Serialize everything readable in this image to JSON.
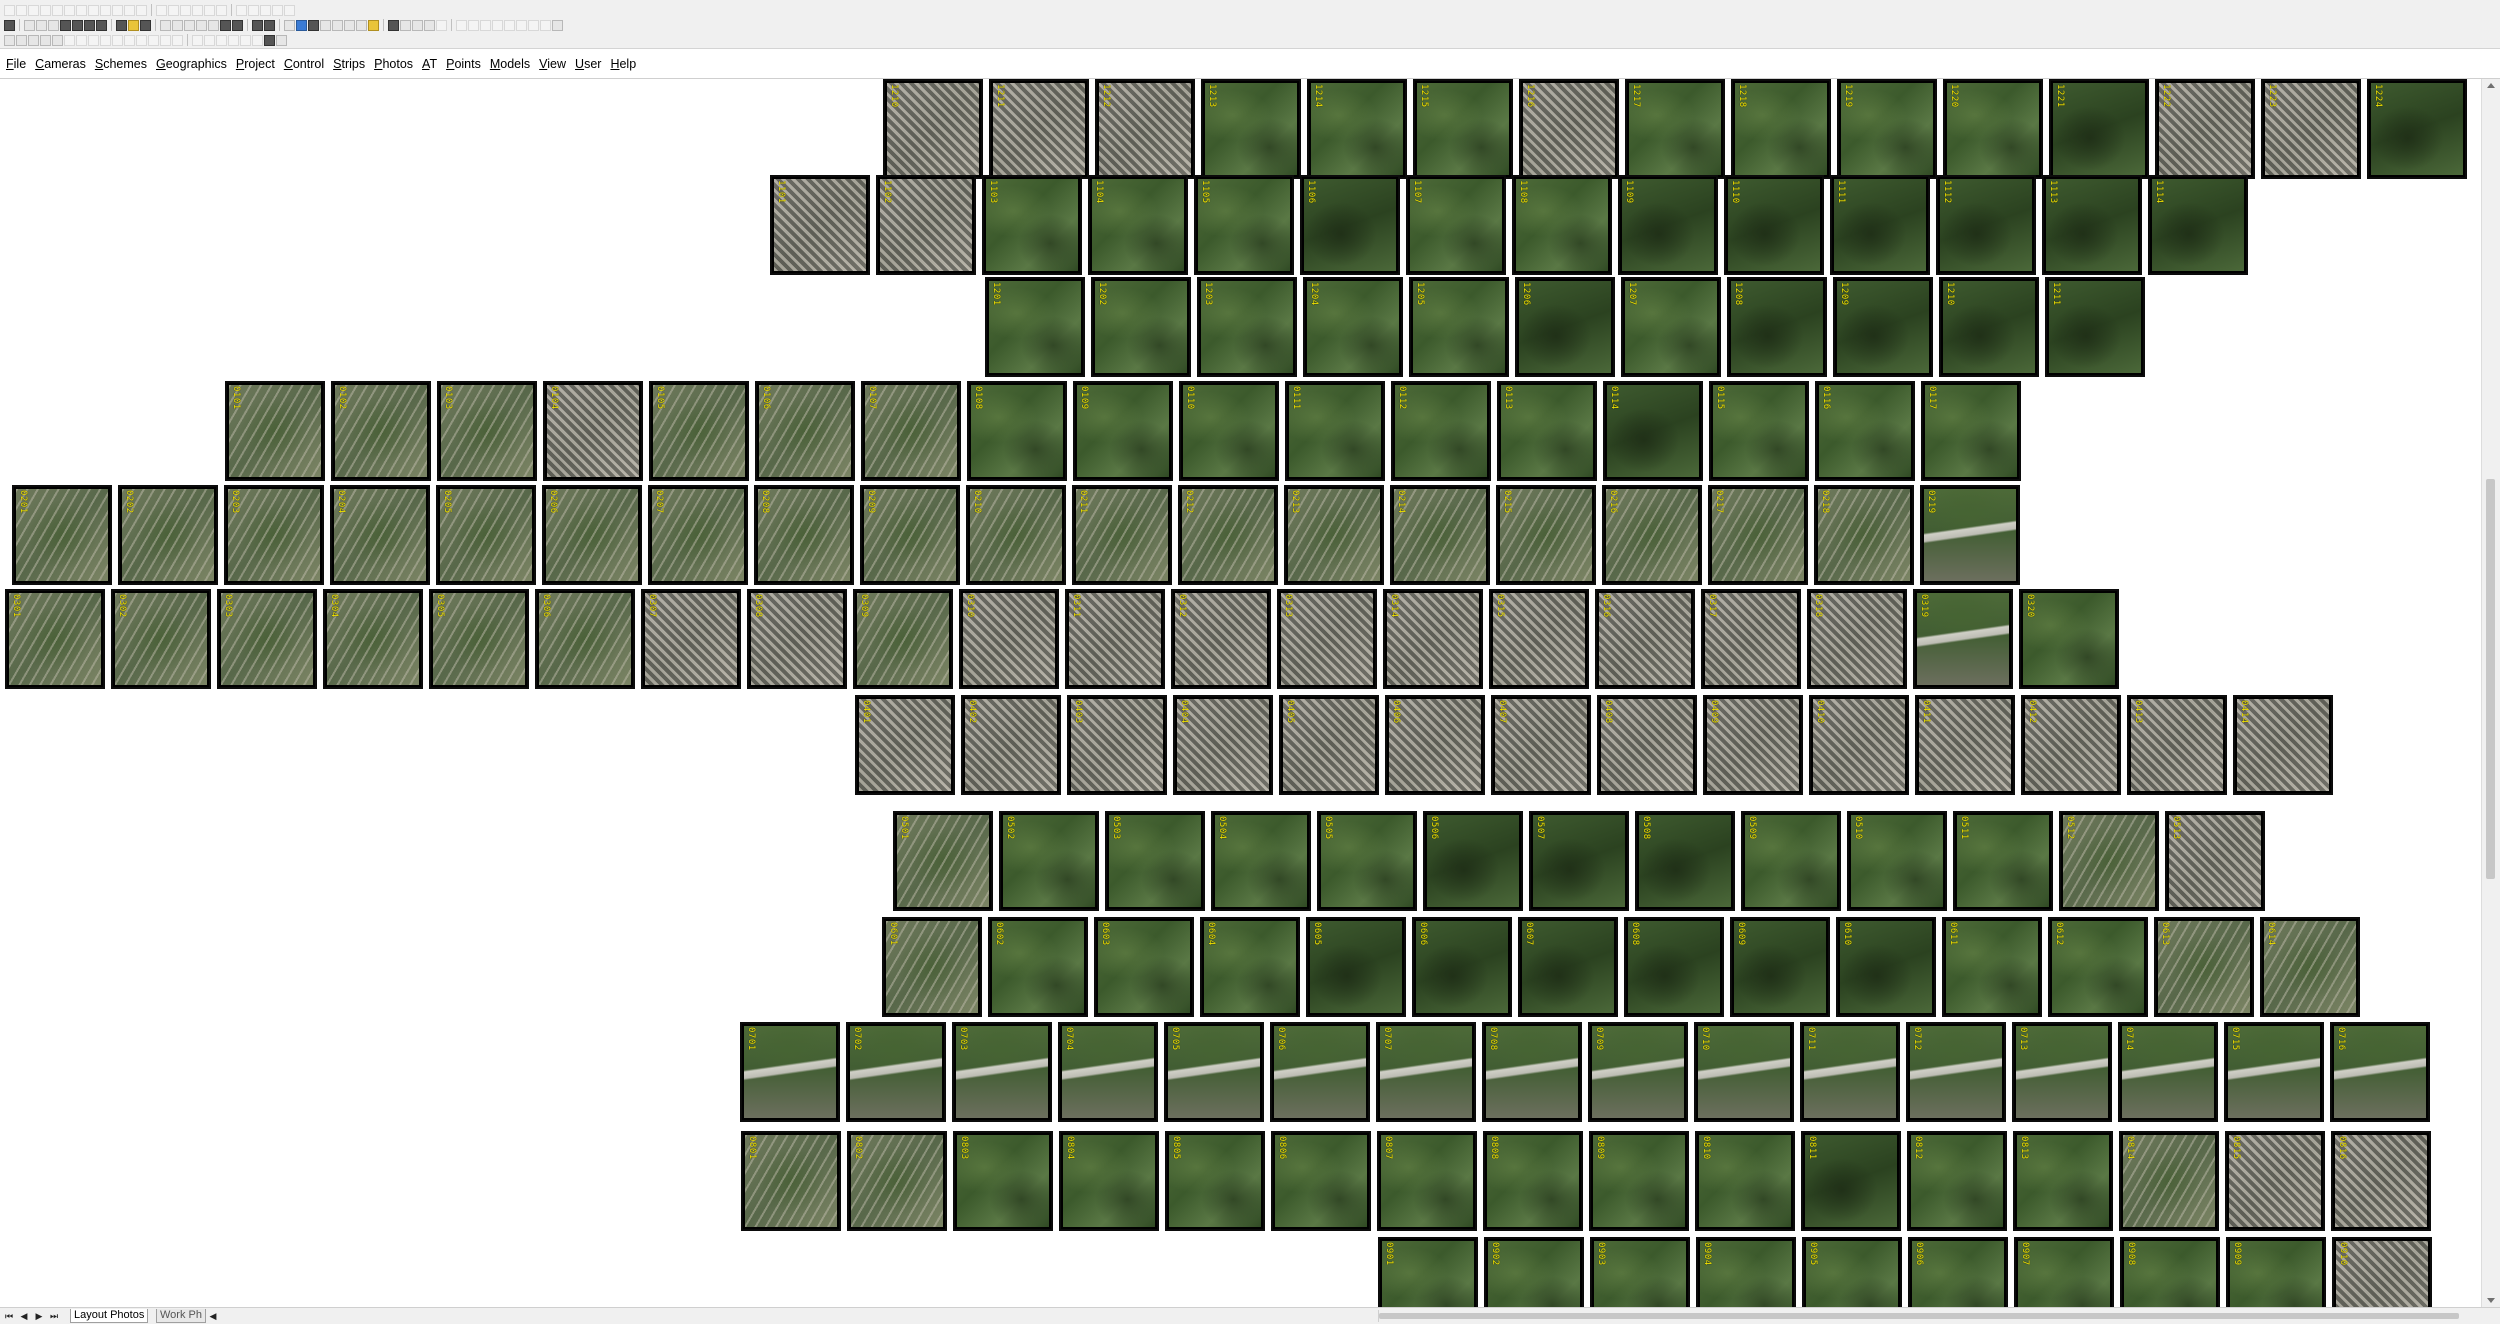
{
  "menu": [
    {
      "label": "File"
    },
    {
      "label": "Cameras"
    },
    {
      "label": "Schemes"
    },
    {
      "label": "Geographics"
    },
    {
      "label": "Project"
    },
    {
      "label": "Control"
    },
    {
      "label": "Strips"
    },
    {
      "label": "Photos"
    },
    {
      "label": "AT"
    },
    {
      "label": "Points"
    },
    {
      "label": "Models"
    },
    {
      "label": "View"
    },
    {
      "label": "User"
    },
    {
      "label": "Help"
    }
  ],
  "tabs": {
    "active": "Layout Photos",
    "inactive": "Work Ph"
  },
  "nav_icons": [
    "first-icon",
    "prev-icon",
    "next-icon",
    "last-icon"
  ],
  "colors": {
    "photo_label": "#f2e400",
    "photo_border": "#0b0b0b"
  },
  "strips": [
    {
      "start": 883,
      "count": 15,
      "offset": 0,
      "prefix": "12",
      "nums": [
        "1210",
        "1211",
        "1212",
        "1213",
        "1214",
        "1215",
        "1216",
        "1217",
        "1218",
        "1219",
        "1220",
        "1221",
        "1222",
        "1223",
        "1224"
      ]
    },
    {
      "start": 770,
      "count": 14,
      "offset": 0,
      "prefix": "11",
      "nums": [
        "1101",
        "1102",
        "1103",
        "1104",
        "1105",
        "1106",
        "1107",
        "1108",
        "1109",
        "1110",
        "1111",
        "1112",
        "1113",
        "1114"
      ]
    },
    {
      "start": 985,
      "count": 11,
      "offset": 0,
      "prefix": "12",
      "nums": [
        "1201",
        "1202",
        "1203",
        "1204",
        "1205",
        "1206",
        "1207",
        "1208",
        "1209",
        "1210",
        "1211"
      ]
    },
    {
      "start": 225,
      "count": 17,
      "offset": 0,
      "prefix": "01",
      "nums": [
        "0101",
        "0102",
        "0103",
        "0104",
        "0105",
        "0106",
        "0107",
        "0108",
        "0109",
        "0110",
        "0111",
        "0112",
        "0113",
        "0114",
        "0115",
        "0116",
        "0117"
      ]
    },
    {
      "start": 12,
      "count": 19,
      "offset": 0,
      "prefix": "02",
      "nums": [
        "0201",
        "0202",
        "0203",
        "0204",
        "0205",
        "0206",
        "0207",
        "0208",
        "0209",
        "0210",
        "0211",
        "0212",
        "0213",
        "0214",
        "0215",
        "0216",
        "0217",
        "0218",
        "0219"
      ]
    },
    {
      "start": 5,
      "count": 20,
      "offset": 0,
      "prefix": "03",
      "nums": [
        "0301",
        "0302",
        "0303",
        "0304",
        "0305",
        "0306",
        "0307",
        "0308",
        "0309",
        "0310",
        "0311",
        "0312",
        "0313",
        "0314",
        "0315",
        "0316",
        "0317",
        "0318",
        "0319",
        "0320"
      ]
    },
    {
      "start": 855,
      "count": 14,
      "offset": 0,
      "prefix": "04",
      "nums": [
        "0401",
        "0402",
        "0403",
        "0404",
        "0405",
        "0406",
        "0407",
        "0408",
        "0409",
        "0410",
        "0411",
        "0412",
        "0413",
        "0414"
      ]
    },
    {
      "start": 893,
      "count": 13,
      "offset": 0,
      "prefix": "05",
      "nums": [
        "0501",
        "0502",
        "0503",
        "0504",
        "0505",
        "0506",
        "0507",
        "0508",
        "0509",
        "0510",
        "0511",
        "0512",
        "0513"
      ]
    },
    {
      "start": 882,
      "count": 14,
      "offset": 0,
      "prefix": "06",
      "nums": [
        "0601",
        "0602",
        "0603",
        "0604",
        "0605",
        "0606",
        "0607",
        "0608",
        "0609",
        "0610",
        "0611",
        "0612",
        "0613",
        "0614"
      ]
    },
    {
      "start": 740,
      "count": 16,
      "offset": 0,
      "prefix": "07",
      "nums": [
        "0701",
        "0702",
        "0703",
        "0704",
        "0705",
        "0706",
        "0707",
        "0708",
        "0709",
        "0710",
        "0711",
        "0712",
        "0713",
        "0714",
        "0715",
        "0716"
      ]
    },
    {
      "start": 741,
      "count": 16,
      "offset": 0,
      "prefix": "08",
      "nums": [
        "0801",
        "0802",
        "0803",
        "0804",
        "0805",
        "0806",
        "0807",
        "0808",
        "0809",
        "0810",
        "0811",
        "0812",
        "0813",
        "0814",
        "0815",
        "0816"
      ]
    },
    {
      "start": 1378,
      "count": 10,
      "offset": 0,
      "prefix": "09",
      "nums": [
        "0901",
        "0902",
        "0903",
        "0904",
        "0905",
        "0906",
        "0907",
        "0908",
        "0909",
        "0910"
      ]
    }
  ]
}
